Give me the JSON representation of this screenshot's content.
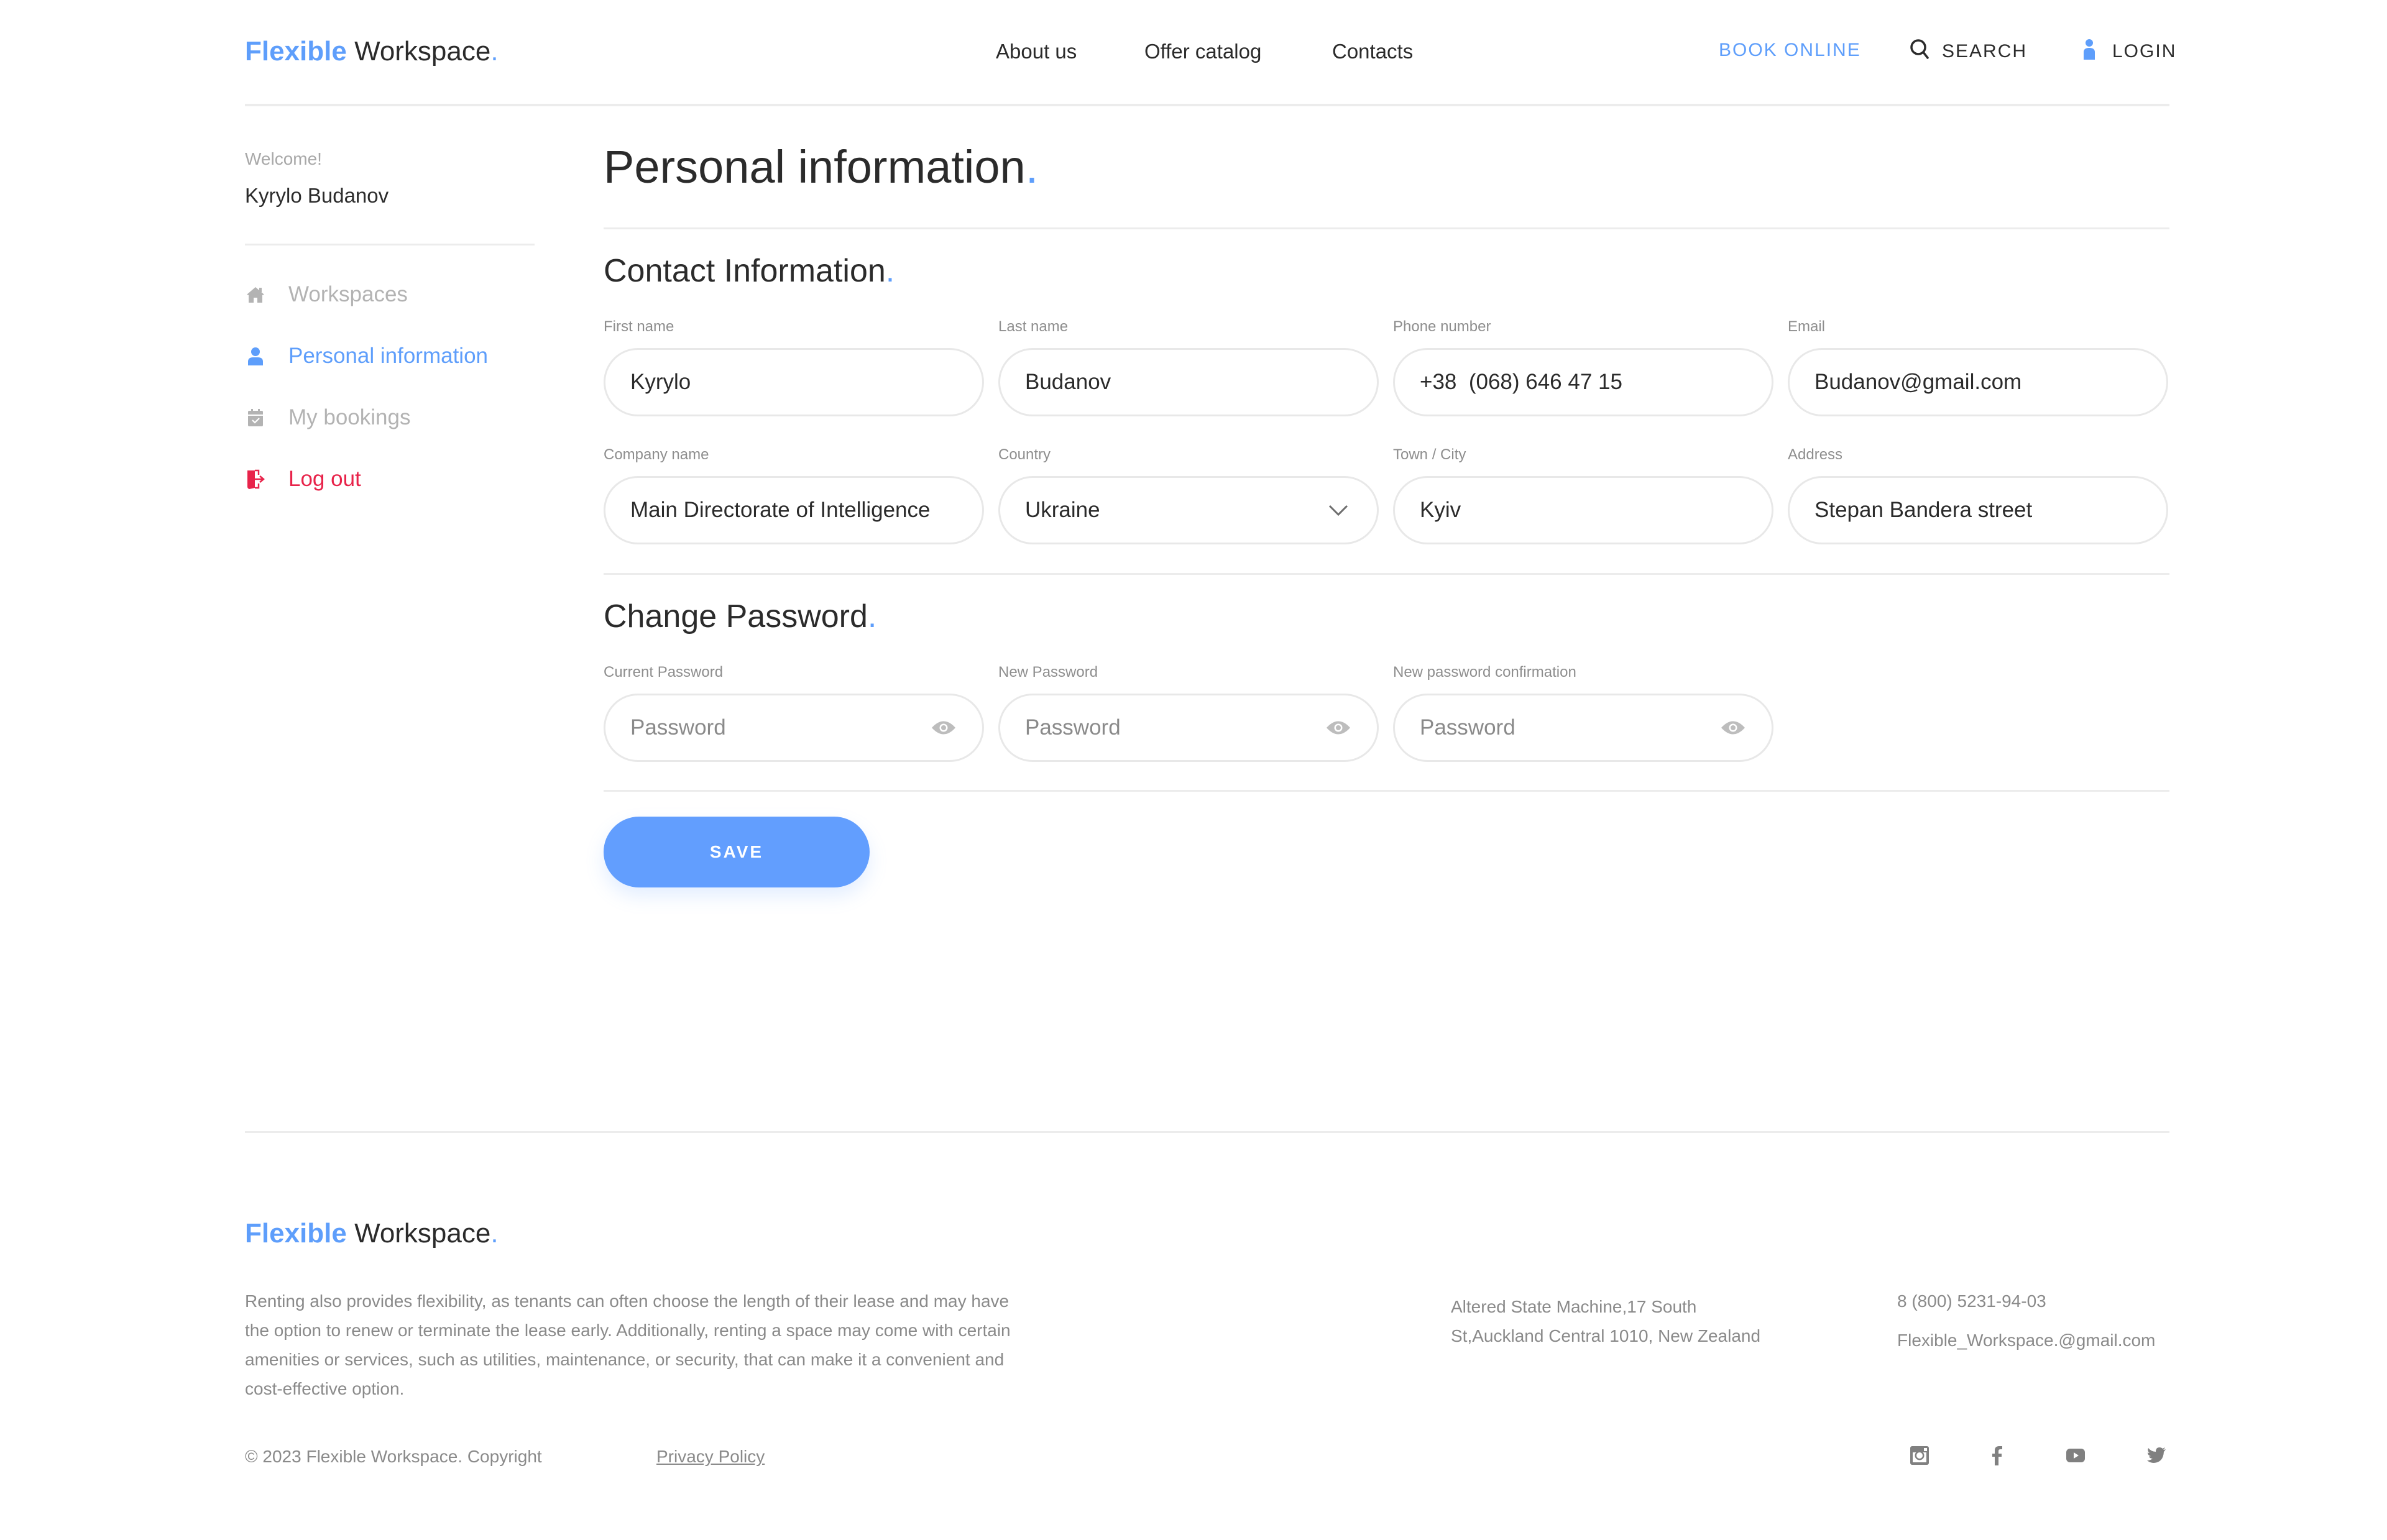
{
  "brand": {
    "part1": "Flexible",
    "part2": "Workspace",
    "dot": "."
  },
  "header": {
    "nav": [
      "About us",
      "Offer catalog",
      "Contacts"
    ],
    "book_online": "BOOK ONLINE",
    "search": "SEARCH",
    "login": "LOGIN"
  },
  "sidebar": {
    "welcome": "Welcome!",
    "user_name": "Kyrylo Budanov",
    "items": [
      {
        "label": "Workspaces",
        "icon": "home-icon",
        "state": "default"
      },
      {
        "label": "Personal information",
        "icon": "user-icon",
        "state": "active"
      },
      {
        "label": "My bookings",
        "icon": "calendar-check-icon",
        "state": "default"
      },
      {
        "label": "Log out",
        "icon": "logout-door-icon",
        "state": "danger"
      }
    ]
  },
  "main": {
    "title": "Personal information",
    "title_dot": ".",
    "contact": {
      "heading": "Contact Information",
      "fields": [
        {
          "label": "First name",
          "value": "Kyrylo"
        },
        {
          "label": "Last name",
          "value": "Budanov"
        },
        {
          "label": "Phone number",
          "value": "+38  (068) 646 47 15"
        },
        {
          "label": "Email",
          "value": "Budanov@gmail.com"
        },
        {
          "label": "Company name",
          "value": "Main Directorate of Intelligence"
        },
        {
          "label": "Country",
          "value": "Ukraine"
        },
        {
          "label": "Town / City",
          "value": "Kyiv"
        },
        {
          "label": "Address",
          "value": "Stepan Bandera street"
        }
      ]
    },
    "password": {
      "heading": "Change Password",
      "fields": [
        {
          "label": "Current Password",
          "placeholder": "Password",
          "value": ""
        },
        {
          "label": "New Password",
          "placeholder": "Password",
          "value": ""
        },
        {
          "label": "New password confirmation",
          "placeholder": "Password",
          "value": ""
        }
      ]
    },
    "save_label": "SAVE"
  },
  "footer": {
    "description": "Renting also provides flexibility, as tenants can often choose the length of their lease and may have the option to renew or terminate the lease early. Additionally, renting a space may come with certain amenities or services, such as utilities, maintenance, or security, that can make it a convenient and cost-effective option.",
    "address_line1": "Altered State Machine,17 South",
    "address_line2": "St,Auckland Central 1010, New Zealand",
    "phone": "8 (800) 5231-94-03",
    "email": "Flexible_Workspace.@gmail.com",
    "copyright": "© 2023 Flexible Workspace. Copyright",
    "privacy": "Privacy Policy",
    "social": [
      "instagram-icon",
      "facebook-icon",
      "youtube-icon",
      "twitter-icon"
    ]
  },
  "colors": {
    "accent": "#5e9efb",
    "button": "#629efe",
    "danger": "#e8234a",
    "muted": "#b3b3b3",
    "text": "#2b2b2b"
  }
}
